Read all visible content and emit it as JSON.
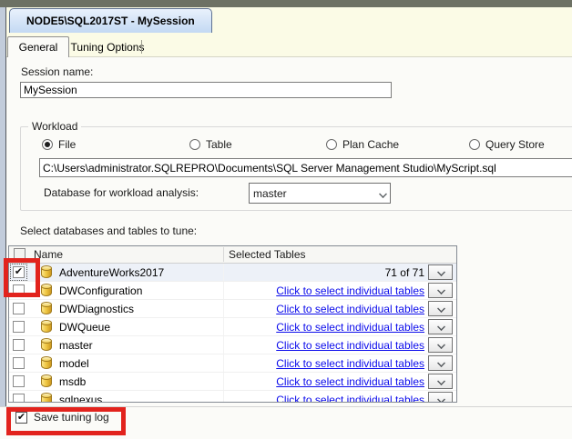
{
  "window": {
    "document_tab": "NODE5\\SQL2017ST - MySession"
  },
  "tabs": [
    {
      "label": "General",
      "active": true
    },
    {
      "label": "Tuning Options",
      "active": false
    }
  ],
  "general": {
    "session_name_label": "Session name:",
    "session_name_value": "MySession",
    "workload": {
      "group_label": "Workload",
      "options": [
        {
          "label": "File",
          "selected": true
        },
        {
          "label": "Table",
          "selected": false
        },
        {
          "label": "Plan Cache",
          "selected": false
        },
        {
          "label": "Query Store",
          "selected": false
        }
      ],
      "file_path": "C:\\Users\\administrator.SQLREPRO\\Documents\\SQL Server Management Studio\\MyScript.sql",
      "database_label": "Database for workload analysis:",
      "database_value": "master"
    },
    "select_tables_label": "Select databases and tables to tune:",
    "table": {
      "columns": [
        "Name",
        "Selected Tables"
      ],
      "rows": [
        {
          "name": "AdventureWorks2017",
          "checked": true,
          "highlighted": true,
          "selected_tables": "71 of 71",
          "is_link": false
        },
        {
          "name": "DWConfiguration",
          "checked": false,
          "highlighted": false,
          "selected_tables": "Click to select individual tables",
          "is_link": true
        },
        {
          "name": "DWDiagnostics",
          "checked": false,
          "highlighted": false,
          "selected_tables": "Click to select individual tables",
          "is_link": true
        },
        {
          "name": "DWQueue",
          "checked": false,
          "highlighted": false,
          "selected_tables": "Click to select individual tables",
          "is_link": true
        },
        {
          "name": "master",
          "checked": false,
          "highlighted": false,
          "selected_tables": "Click to select individual tables",
          "is_link": true
        },
        {
          "name": "model",
          "checked": false,
          "highlighted": false,
          "selected_tables": "Click to select individual tables",
          "is_link": true
        },
        {
          "name": "msdb",
          "checked": false,
          "highlighted": false,
          "selected_tables": "Click to select individual tables",
          "is_link": true
        },
        {
          "name": "sqlnexus",
          "checked": false,
          "highlighted": false,
          "selected_tables": "Click to select individual tables",
          "is_link": true
        }
      ]
    }
  },
  "footer": {
    "save_tuning_log_label": "Save tuning log",
    "save_tuning_log_checked": true
  },
  "colors": {
    "annotation_red": "#e2231d",
    "link_blue": "#0b0beb",
    "document_tab_blue": "#c3d9f3",
    "tab_strip_cream": "#fbfbe6",
    "selected_row": "#edf1f8"
  }
}
